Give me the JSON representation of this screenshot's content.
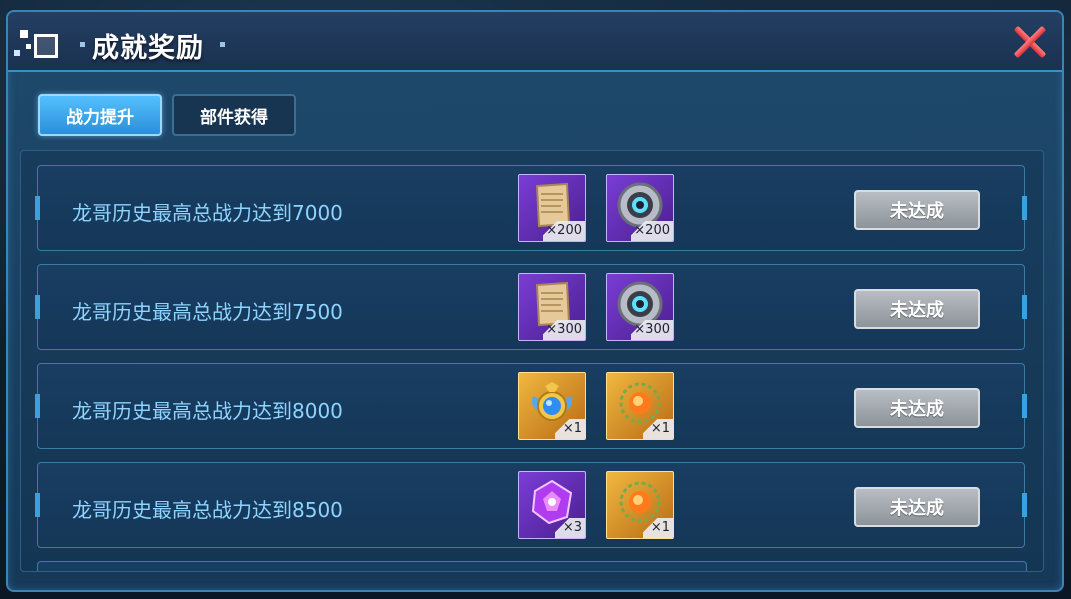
{
  "dialog": {
    "title": "成就奖励",
    "close_icon": "close-x-icon"
  },
  "tabs": [
    {
      "label": "战力提升",
      "active": true
    },
    {
      "label": "部件获得",
      "active": false
    }
  ],
  "achievements": [
    {
      "description": "龙哥历史最高总战力达到7000",
      "status": "未达成",
      "rewards": [
        {
          "icon": "parchment-scroll-icon",
          "quality": "purple",
          "qty": "×200"
        },
        {
          "icon": "gear-wheel-icon",
          "quality": "purple",
          "qty": "×200"
        }
      ]
    },
    {
      "description": "龙哥历史最高总战力达到7500",
      "status": "未达成",
      "rewards": [
        {
          "icon": "parchment-scroll-icon",
          "quality": "purple",
          "qty": "×300"
        },
        {
          "icon": "gear-wheel-icon",
          "quality": "purple",
          "qty": "×300"
        }
      ]
    },
    {
      "description": "龙哥历史最高总战力达到8000",
      "status": "未达成",
      "rewards": [
        {
          "icon": "winged-medal-icon",
          "quality": "gold",
          "qty": "×1"
        },
        {
          "icon": "fire-orb-icon",
          "quality": "gold",
          "qty": "×1"
        }
      ]
    },
    {
      "description": "龙哥历史最高总战力达到8500",
      "status": "未达成",
      "rewards": [
        {
          "icon": "purple-crystal-icon",
          "quality": "purple",
          "qty": "×3"
        },
        {
          "icon": "fire-orb-icon",
          "quality": "gold",
          "qty": "×1"
        }
      ]
    }
  ]
}
